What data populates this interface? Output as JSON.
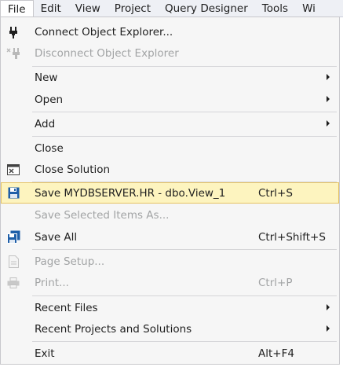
{
  "menubar": {
    "items": [
      "File",
      "Edit",
      "View",
      "Project",
      "Query Designer",
      "Tools",
      "Wi"
    ]
  },
  "file_menu": {
    "connect": "Connect Object Explorer...",
    "disconnect": "Disconnect Object Explorer",
    "new": "New",
    "open": "Open",
    "add": "Add",
    "close": "Close",
    "close_solution": "Close Solution",
    "save": "Save MYDBSERVER.HR - dbo.View_1",
    "save_shortcut": "Ctrl+S",
    "save_selected": "Save Selected Items As...",
    "save_all": "Save All",
    "save_all_shortcut": "Ctrl+Shift+S",
    "page_setup": "Page Setup...",
    "print": "Print...",
    "print_shortcut": "Ctrl+P",
    "recent_files": "Recent Files",
    "recent_projects": "Recent Projects and Solutions",
    "exit": "Exit",
    "exit_shortcut": "Alt+F4"
  },
  "colors": {
    "highlight": "#fdf4bf",
    "disabled_text": "#a2a4a5",
    "save_icon": "#1f5fa8"
  },
  "icons": {
    "connect": "plug-icon",
    "disconnect": "unplug-icon",
    "close_solution": "close-solution-icon",
    "save": "floppy-disk-icon",
    "save_all": "save-all-icon",
    "page_setup": "page-setup-icon",
    "print": "printer-icon"
  }
}
